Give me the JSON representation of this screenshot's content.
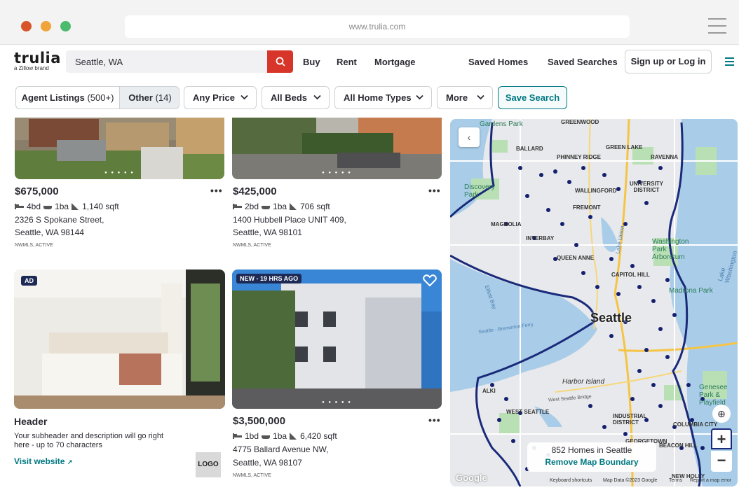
{
  "browser": {
    "url": "www.trulia.com"
  },
  "brand": {
    "name": "trulia",
    "tagline": "a Zillow brand"
  },
  "search": {
    "value": "Seattle, WA"
  },
  "nav": {
    "buy": "Buy",
    "rent": "Rent",
    "mortgage": "Mortgage",
    "saved_homes": "Saved Homes",
    "saved_searches": "Saved Searches",
    "signup": "Sign up or Log in"
  },
  "filters": {
    "agent_listings": "Agent Listings",
    "agent_count": "(500+)",
    "other": "Other",
    "other_count": "(14)",
    "price": "Any Price",
    "beds": "All Beds",
    "home_types": "All Home Types",
    "more": "More",
    "save_search": "Save Search"
  },
  "listings": [
    {
      "price": "$675,000",
      "beds": "4bd",
      "baths": "1ba",
      "sqft": "1,140 sqft",
      "address1": "2326 S Spokane Street,",
      "address2": "Seattle, WA 98144",
      "mls": "NWMLS, ACTIVE"
    },
    {
      "price": "$425,000",
      "beds": "2bd",
      "baths": "1ba",
      "sqft": "706 sqft",
      "address1": "1400 Hubbell Place UNIT 409,",
      "address2": "Seattle, WA 98101",
      "mls": "NWMLS, ACTIVE"
    },
    {
      "price": "$3,500,000",
      "beds": "1bd",
      "baths": "1ba",
      "sqft": "6,420 sqft",
      "address1": "4775 Ballard Avenue NW,",
      "address2": "Seattle, WA 98107",
      "mls": "NWMLS, ACTIVE",
      "badge": "NEW - 19 HRS AGO"
    }
  ],
  "ad": {
    "badge": "AD",
    "header": "Header",
    "description": "Your subheader and description will go right here - up to 70 characters",
    "link": "Visit website",
    "logo": "LOGO"
  },
  "map": {
    "labels": {
      "gardens_park": "Gardens Park",
      "greenwood": "GREENWOOD",
      "ballard": "BALLARD",
      "phinney_ridge": "PHINNEY RIDGE",
      "green_lake": "GREEN LAKE",
      "ravenna": "RAVENNA",
      "discovery_park": "Discovery Park",
      "wallingford": "WALLINGFORD",
      "university_district": "UNIVERSITY DISTRICT",
      "fremont": "FREMONT",
      "magnolia": "MAGNOLIA",
      "washington_park": "Washington Park Arboretum",
      "interbay": "INTERBAY",
      "queen_anne": "QUEEN ANNE",
      "capitol_hill": "CAPITOL HILL",
      "madrona_park": "Madrona Park",
      "seattle": "Seattle",
      "harbor_island": "Harbor Island",
      "west_seattle": "WEST SEATTLE",
      "industrial_district": "INDUSTRIAL DISTRICT",
      "genesee_park": "Genesee Park & Playfield",
      "columbia_city": "COLUMBIA CITY",
      "beacon_hill": "BEACON HILL",
      "new_holly": "NEW HOLLY",
      "alki": "ALKI",
      "georgetown": "GEORGETOWN",
      "lake_union": "Lake Union",
      "lake_washington": "Lake Washington",
      "elliott_bay": "Elliott Bay",
      "ferry": "Seattle - Bremerton Ferry",
      "west_seattle_bridge": "West Seattle Bridge"
    },
    "count": "852 Homes in Seattle",
    "remove_boundary": "Remove Map Boundary",
    "zoom_in": "+",
    "zoom_out": "−",
    "google": "Google",
    "attribution": {
      "shortcuts": "Keyboard shortcuts",
      "data": "Map Data ©2023 Google",
      "terms": "Terms",
      "report": "Report a map error"
    }
  }
}
